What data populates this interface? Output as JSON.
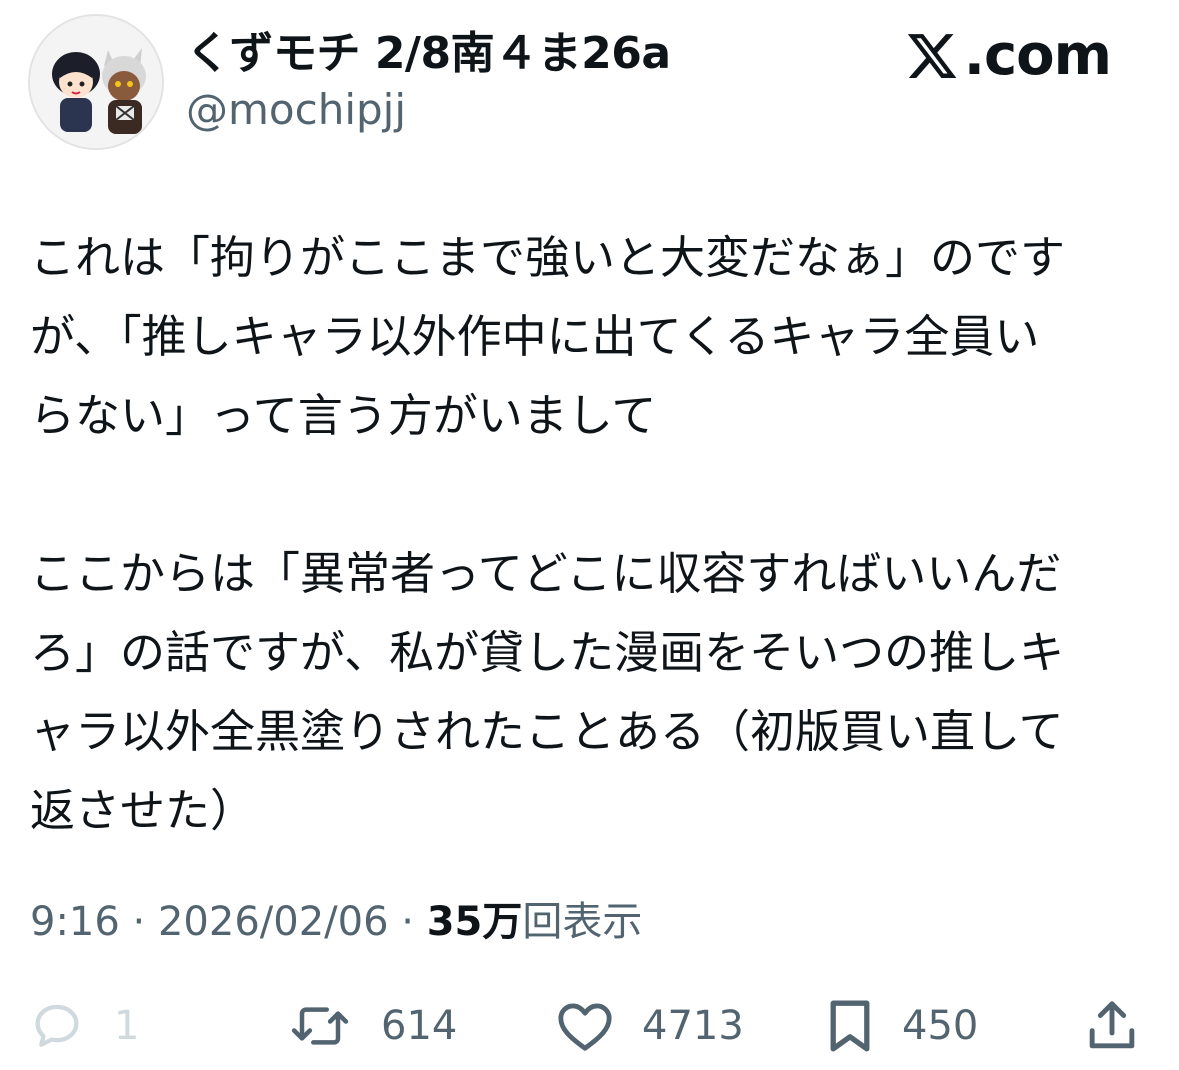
{
  "author": {
    "display_name": "くずモチ 2/8南４ま26a",
    "handle": "@mochipjj"
  },
  "brand": {
    "domain": ".com",
    "logo_icon": "x-logo-icon"
  },
  "tweet": {
    "paragraph1_lines": [
      "これは「拘りがここまで強いと大変だなぁ」のです",
      "が、「推しキャラ以外作中に出てくるキャラ全員い",
      "らない」って言う方がいまして"
    ],
    "paragraph2_lines": [
      "ここからは「異常者ってどこに収容すればいいんだ",
      "ろ」の話ですが、私が貸した漫画をそいつの推しキ",
      "ャラ以外全黒塗りされたことある（初版買い直して",
      "返させた）"
    ]
  },
  "meta": {
    "time": "9:16",
    "separator": " · ",
    "date": "2026/02/06",
    "views_count": "35万",
    "views_label": "回表示"
  },
  "actions": {
    "reply_count": "1",
    "retweet_count": "614",
    "like_count": "4713",
    "bookmark_count": "450"
  },
  "colors": {
    "text": "#0f1419",
    "secondary": "#536471",
    "disabled": "#cfd9de"
  }
}
